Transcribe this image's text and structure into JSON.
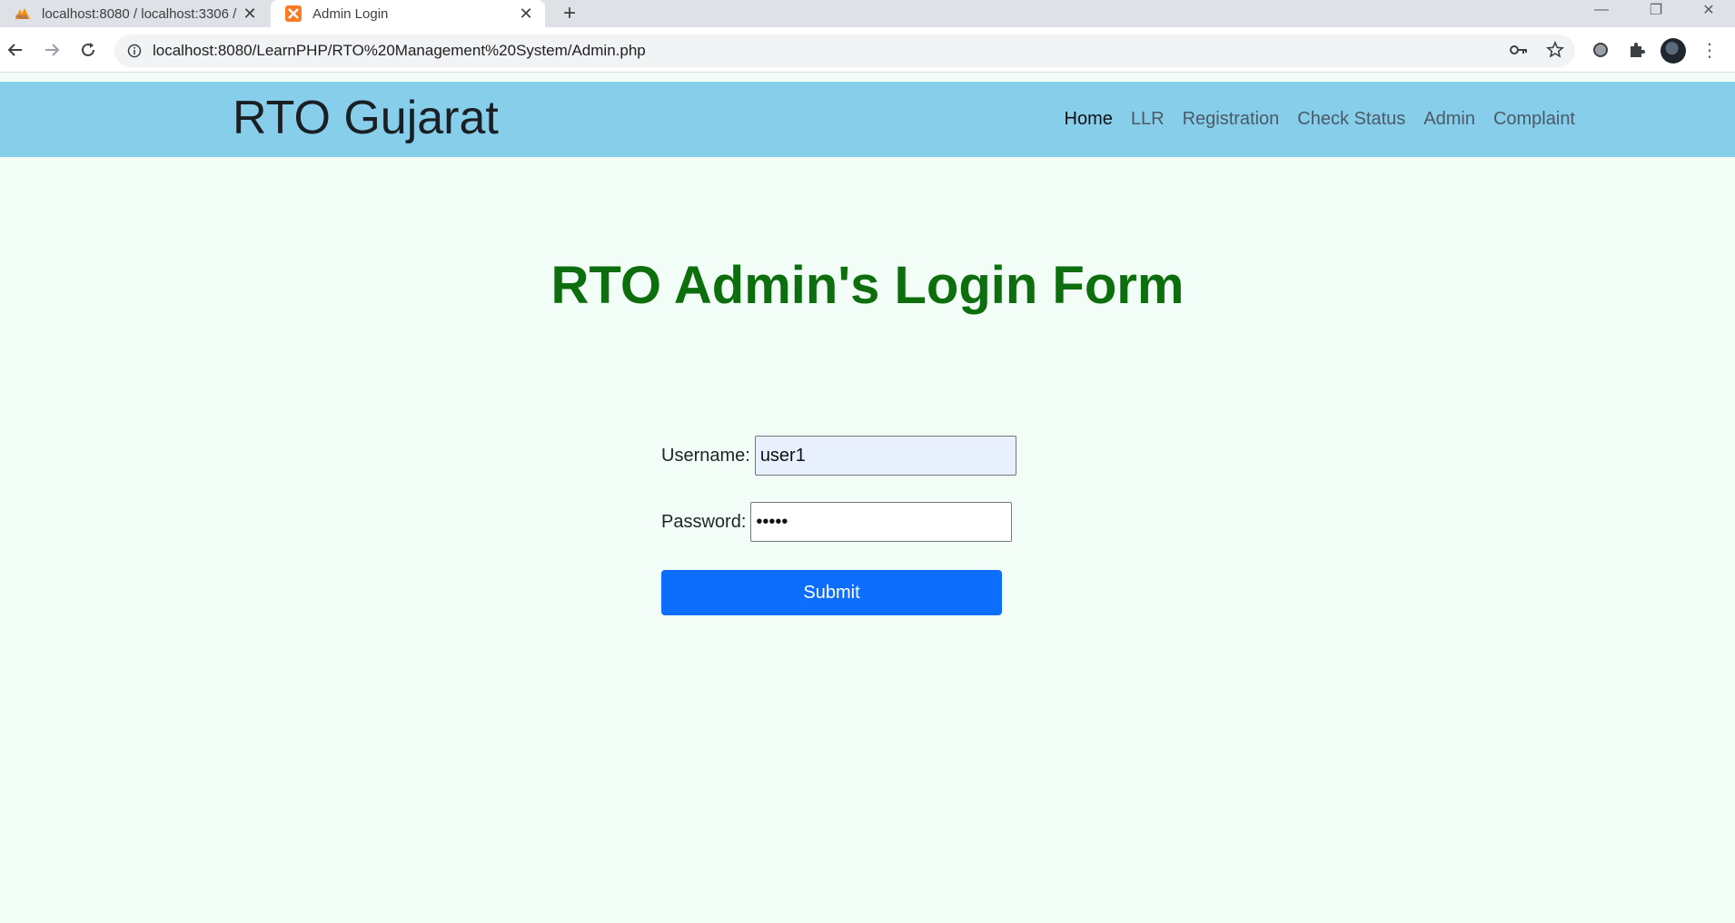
{
  "browser": {
    "tabs": [
      {
        "title": "localhost:8080 / localhost:3306 /",
        "icon": "phpmyadmin-icon",
        "active": false
      },
      {
        "title": "Admin Login",
        "icon": "xampp-icon",
        "active": true
      }
    ],
    "url": "localhost:8080/LearnPHP/RTO%20Management%20System/Admin.php"
  },
  "navbar": {
    "brand": "RTO Gujarat",
    "links": [
      "Home",
      "LLR",
      "Registration",
      "Check Status",
      "Admin",
      "Complaint"
    ],
    "background": "#87ceeb"
  },
  "main": {
    "heading": "RTO Admin's Login Form",
    "heading_color": "#0c6e0c",
    "form": {
      "username_label": "Username:",
      "username_value": "user1",
      "password_label": "Password:",
      "password_value": "•••••",
      "submit_label": "Submit",
      "submit_color": "#0d6efd"
    }
  }
}
